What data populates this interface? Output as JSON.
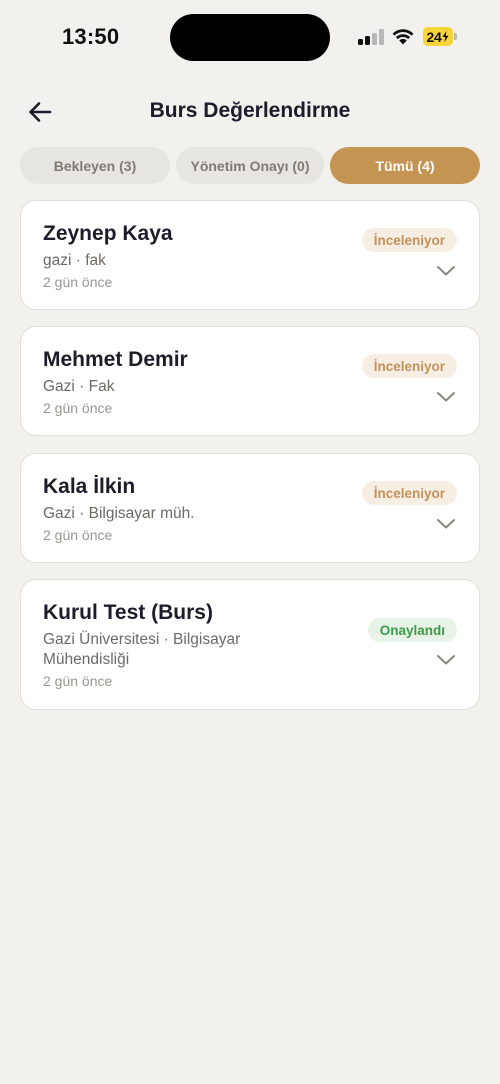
{
  "status_bar": {
    "time": "13:50",
    "battery": "24"
  },
  "header": {
    "title": "Burs Değerlendirme",
    "back_icon": "arrow-left-icon"
  },
  "tabs": [
    {
      "label": "Bekleyen (3)",
      "active": false
    },
    {
      "label": "Yönetim Onayı (0)",
      "active": false
    },
    {
      "label": "Tümü (4)",
      "active": true
    }
  ],
  "applications": [
    {
      "name": "Zeynep Kaya",
      "subtitle": "gazi · fak",
      "time": "2 gün önce",
      "status": "İnceleniyor"
    },
    {
      "name": "Mehmet Demir",
      "subtitle": "Gazi · Fak",
      "time": "2 gün önce",
      "status": "İnceleniyor"
    },
    {
      "name": "Kala İlkin",
      "subtitle": "Gazi · Bilgisayar müh.",
      "time": "2 gün önce",
      "status": "İnceleniyor"
    },
    {
      "name": "Kurul Test (Burs)",
      "subtitle": "Gazi Üniversitesi · Bilgisayar Mühendisliği",
      "time": "2 gün önce",
      "status": "Onaylandı"
    }
  ],
  "colors": {
    "accent": "#c49453",
    "pending_text": "#c3925a",
    "pending_bg": "#f6ede3",
    "approved_text": "#3d9a4a",
    "approved_bg": "#e7f3e7",
    "background": "#f3f1ed"
  }
}
